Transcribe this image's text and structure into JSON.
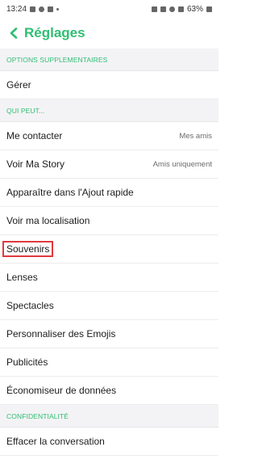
{
  "status_bar": {
    "time": "13:24",
    "battery": "63%"
  },
  "header": {
    "title": "Réglages"
  },
  "sections": [
    {
      "header": "OPTIONS SUPPLEMENTAIRES",
      "items": [
        {
          "label": "Gérer",
          "value": ""
        }
      ]
    },
    {
      "header": "QUI PEUT...",
      "items": [
        {
          "label": "Me contacter",
          "value": "Mes amis"
        },
        {
          "label": "Voir Ma Story",
          "value": "Amis uniquement"
        },
        {
          "label": "Apparaître dans l'Ajout rapide",
          "value": ""
        },
        {
          "label": "Voir ma localisation",
          "value": ""
        },
        {
          "label": "Souvenirs",
          "value": ""
        },
        {
          "label": "Lenses",
          "value": ""
        },
        {
          "label": "Spectacles",
          "value": ""
        },
        {
          "label": "Personnaliser des Emojis",
          "value": ""
        },
        {
          "label": "Publicités",
          "value": ""
        },
        {
          "label": "Économiseur de données",
          "value": ""
        }
      ]
    },
    {
      "header": "CONFIDENTIALITÉ",
      "items": [
        {
          "label": "Effacer la conversation",
          "value": ""
        }
      ]
    }
  ],
  "colors": {
    "accent": "#2fbe73",
    "highlight_border": "#e0393e"
  }
}
